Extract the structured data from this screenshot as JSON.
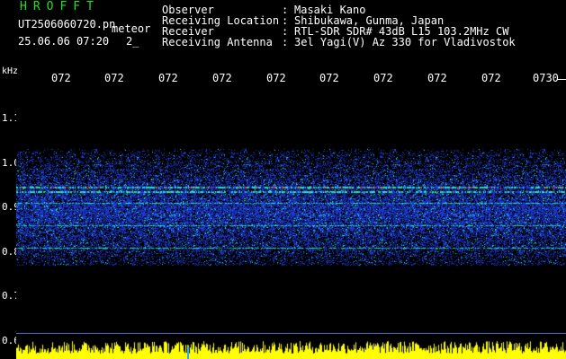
{
  "header": {
    "app_title": "HROFFT",
    "filename": "UT2506060720.pn",
    "meteor_label": "meteor",
    "timestamp": "25.06.06 07:20",
    "count": "2_",
    "meta": [
      {
        "label": "Observer",
        "value": "Masaki Kano"
      },
      {
        "label": "Receiving Location",
        "value": "Shibukawa, Gunma, Japan"
      },
      {
        "label": "Receiver",
        "value": "RTL-SDR SDR# 43dB L15 103.2MHz CW"
      },
      {
        "label": "Receiving Antenna",
        "value": "3el Yagi(V) Az 330 for Vladivostok"
      }
    ]
  },
  "axes": {
    "y_unit": "kHz",
    "y_ticks": [
      "1.1",
      "1.0",
      "0.9",
      "0.8",
      "0.7",
      "0.6"
    ],
    "time_ticks": [
      "072",
      "072",
      "072",
      "072",
      "072",
      "072",
      "072",
      "072",
      "072",
      "0730"
    ]
  },
  "spectrogram": {
    "y_range_khz": [
      0.6,
      1.12
    ],
    "signal_band_khz": [
      0.78,
      1.0
    ],
    "lines_khz": [
      0.945,
      0.935,
      0.91,
      0.86,
      0.81
    ],
    "colors": {
      "background": "#000000",
      "noise": "#1e3cdc",
      "signal": "#22e0e0",
      "strong": "#ff2020",
      "audio": "#ffff00"
    }
  }
}
